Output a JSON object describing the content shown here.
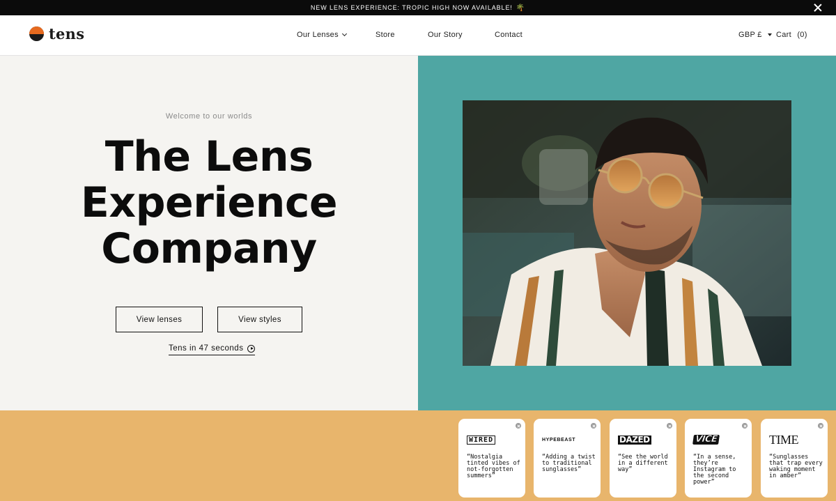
{
  "announcement": {
    "text": "NEW LENS EXPERIENCE: TROPIC HIGH NOW AVAILABLE!",
    "emoji": "🌴",
    "close_icon": "close-icon"
  },
  "header": {
    "logo_text": "tens",
    "nav": {
      "our_lenses": "Our Lenses",
      "store": "Store",
      "our_story": "Our Story",
      "contact": "Contact"
    },
    "currency": "GBP £",
    "cart": "Cart",
    "cart_count": "(0)"
  },
  "hero": {
    "eyebrow": "Welcome to our worlds",
    "headline_line1": "The Lens",
    "headline_line2": "Experience",
    "headline_line3": "Company",
    "view_lenses": "View lenses",
    "view_styles": "View styles",
    "video_link": "Tens in 47 seconds",
    "colors": {
      "left_bg": "#f5f4f1",
      "right_bg": "#4fa6a3",
      "press_bg": "#e8b56c",
      "logo_orange": "#e66a1f"
    }
  },
  "press": [
    {
      "brand": "WIRED",
      "quote": "“Nostalgia tinted vibes of not-forgotten summers”"
    },
    {
      "brand": "HYPEBEAST",
      "quote": "“Adding a twist to traditional sunglasses”"
    },
    {
      "brand": "DAZED",
      "quote": "“See the world in a different way”"
    },
    {
      "brand": "VICE",
      "quote": "“In a sense, they’re Instagram to the second power”"
    },
    {
      "brand": "TIME",
      "quote": "“Sunglasses that trap every waking moment in amber”"
    }
  ]
}
